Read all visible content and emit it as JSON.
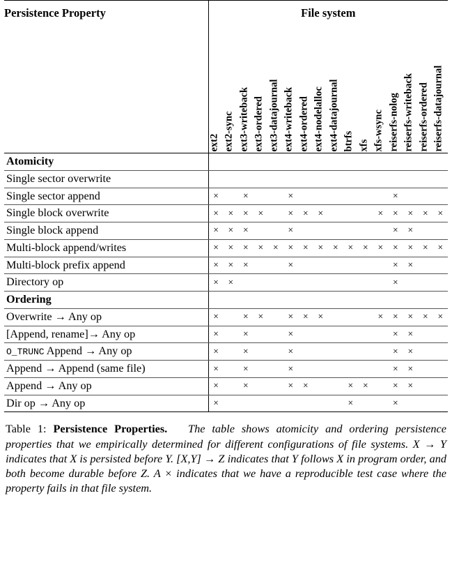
{
  "header": {
    "property_column_title": "Persistence Property",
    "filesystem_group_title": "File system"
  },
  "columns": [
    "ext2",
    "ext2-sync",
    "ext3-writeback",
    "ext3-ordered",
    "ext3-datajournal",
    "ext4-writeback",
    "ext4-ordered",
    "ext4-nodelalloc",
    "ext4-datajournal",
    "btrfs",
    "xfs",
    "xfs-wsync",
    "reiserfs-nolog",
    "reiserfs-writeback",
    "reiserfs-ordered",
    "reiserfs-datajournal"
  ],
  "mark": "×",
  "sections": [
    {
      "title": "Atomicity",
      "rows": [
        {
          "label": "Single sector overwrite",
          "marks": [
            0,
            0,
            0,
            0,
            0,
            0,
            0,
            0,
            0,
            0,
            0,
            0,
            0,
            0,
            0,
            0
          ]
        },
        {
          "label": "Single sector append",
          "marks": [
            1,
            0,
            1,
            0,
            0,
            1,
            0,
            0,
            0,
            0,
            0,
            0,
            1,
            0,
            0,
            0
          ]
        },
        {
          "label": "Single block overwrite",
          "marks": [
            1,
            1,
            1,
            1,
            0,
            1,
            1,
            1,
            0,
            0,
            0,
            1,
            1,
            1,
            1,
            1
          ]
        },
        {
          "label": "Single block append",
          "marks": [
            1,
            1,
            1,
            0,
            0,
            1,
            0,
            0,
            0,
            0,
            0,
            0,
            1,
            1,
            0,
            0
          ]
        },
        {
          "label": "Multi-block append/writes",
          "marks": [
            1,
            1,
            1,
            1,
            1,
            1,
            1,
            1,
            1,
            1,
            1,
            1,
            1,
            1,
            1,
            1
          ]
        },
        {
          "label": "Multi-block prefix append",
          "marks": [
            1,
            1,
            1,
            0,
            0,
            1,
            0,
            0,
            0,
            0,
            0,
            0,
            1,
            1,
            0,
            0
          ]
        },
        {
          "label": "Directory op",
          "marks": [
            1,
            1,
            0,
            0,
            0,
            0,
            0,
            0,
            0,
            0,
            0,
            0,
            1,
            0,
            0,
            0
          ]
        }
      ]
    },
    {
      "title": "Ordering",
      "rows": [
        {
          "label": "Overwrite → Any op",
          "marks": [
            1,
            0,
            1,
            1,
            0,
            1,
            1,
            1,
            0,
            0,
            0,
            1,
            1,
            1,
            1,
            1
          ]
        },
        {
          "label": "[Append, rename]→ Any op",
          "marks": [
            1,
            0,
            1,
            0,
            0,
            1,
            0,
            0,
            0,
            0,
            0,
            0,
            1,
            1,
            0,
            0
          ]
        },
        {
          "label": "O_TRUNC Append → Any op",
          "label_prefix_smallcaps": "O_TRUNC",
          "label_rest": " Append → Any op",
          "marks": [
            1,
            0,
            1,
            0,
            0,
            1,
            0,
            0,
            0,
            0,
            0,
            0,
            1,
            1,
            0,
            0
          ]
        },
        {
          "label": "Append → Append (same file)",
          "marks": [
            1,
            0,
            1,
            0,
            0,
            1,
            0,
            0,
            0,
            0,
            0,
            0,
            1,
            1,
            0,
            0
          ]
        },
        {
          "label": "Append → Any op",
          "marks": [
            1,
            0,
            1,
            0,
            0,
            1,
            1,
            0,
            0,
            1,
            1,
            0,
            1,
            1,
            0,
            0
          ]
        },
        {
          "label": "Dir op → Any op",
          "marks": [
            1,
            0,
            0,
            0,
            0,
            0,
            0,
            0,
            0,
            1,
            0,
            0,
            1,
            0,
            0,
            0
          ]
        }
      ]
    }
  ],
  "caption": {
    "number": "Table 1:",
    "bold_title": "Persistence Properties.",
    "body": "The table shows atomicity and ordering persistence properties that we empirically determined for different configurations of file systems. X → Y indicates that X is persisted before Y. [X,Y] → Z indicates that Y follows X in program order, and both become durable before Z. A × indicates that we have a reproducible test case where the property fails in that file system."
  }
}
